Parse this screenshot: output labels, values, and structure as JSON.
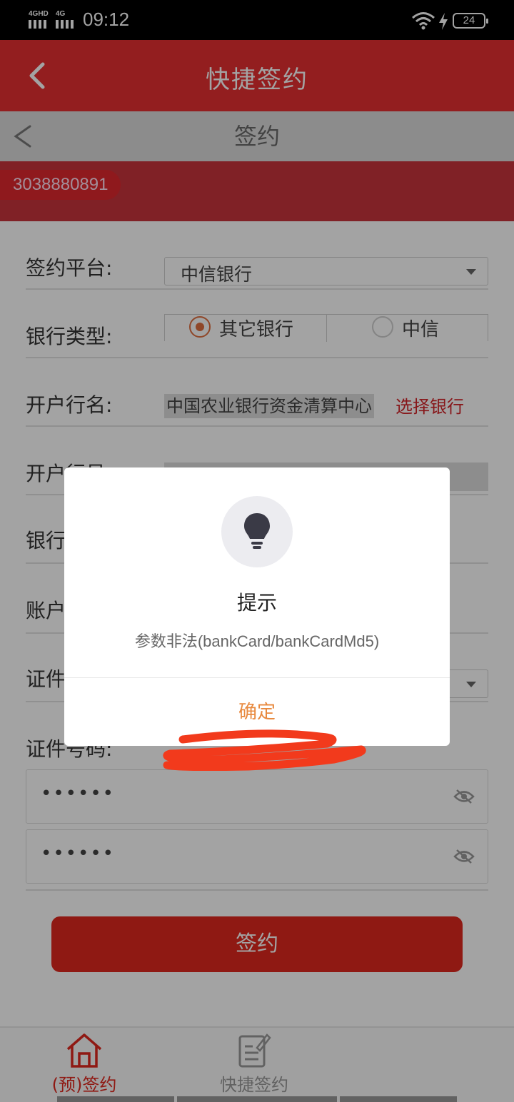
{
  "status_bar": {
    "network_1": "4GHD",
    "network_2": "4G",
    "time": "09:12",
    "battery": "24",
    "icons": [
      "signal-icon",
      "wifi-icon",
      "charging-icon",
      "battery-icon"
    ]
  },
  "header": {
    "title": "快捷签约",
    "back_icon": "chevron-left-icon"
  },
  "sub_header": {
    "title": "签约",
    "back_icon": "chevron-left-icon"
  },
  "account": {
    "number": "3038880891"
  },
  "form": {
    "platform": {
      "label": "签约平台:",
      "value": "中信银行"
    },
    "bank_type": {
      "label": "银行类型:",
      "options": [
        {
          "label": "其它银行",
          "selected": true
        },
        {
          "label": "中信",
          "selected": false
        }
      ]
    },
    "bank_name": {
      "label": "开户行名:",
      "value": "中国农业银行资金清算中心",
      "action": "选择银行"
    },
    "bank_no": {
      "label": "开户行号:"
    },
    "bank_account": {
      "label": "银行"
    },
    "account_name": {
      "label": "账户"
    },
    "id_type": {
      "label": "证件"
    },
    "id_number": {
      "label": "证件号码:"
    },
    "password_1": {
      "value": "••••••"
    },
    "password_2": {
      "value": "••••••"
    },
    "submit_label": "签约"
  },
  "bottom_nav": {
    "items": [
      {
        "label": "(预)签约",
        "icon": "home-icon",
        "active": true
      },
      {
        "label": "快捷签约",
        "icon": "document-edit-icon",
        "active": false
      }
    ]
  },
  "dialog": {
    "icon": "lightbulb-icon",
    "title": "提示",
    "message": "参数非法(bankCard/bankCardMd5)",
    "confirm_label": "确定"
  },
  "colors": {
    "brand_red": "#e73031",
    "button_red": "#e0281e",
    "confirm_orange": "#e8893e",
    "link_red": "#d4242a"
  }
}
